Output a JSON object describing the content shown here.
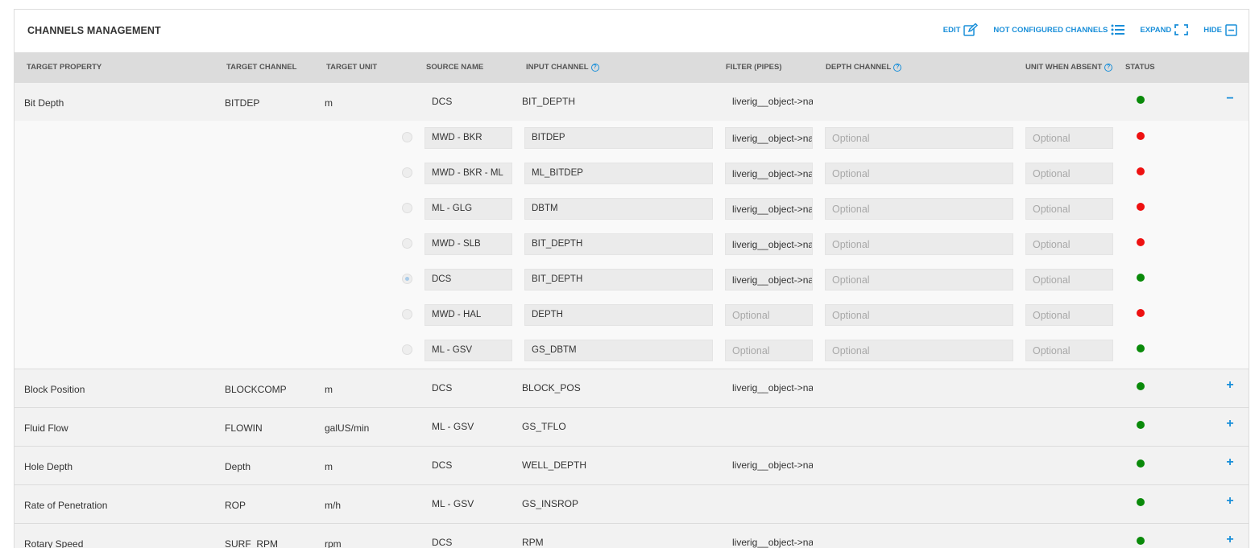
{
  "header": {
    "title": "CHANNELS MANAGEMENT",
    "actions": {
      "edit": "EDIT",
      "not_configured": "NOT CONFIGURED CHANNELS",
      "expand": "EXPAND",
      "hide": "HIDE"
    }
  },
  "columns": {
    "target_property": "TARGET PROPERTY",
    "target_channel": "TARGET CHANNEL",
    "target_unit": "TARGET UNIT",
    "source_name": "SOURCE NAME",
    "input_channel": "INPUT CHANNEL",
    "filter": "FILTER (PIPES)",
    "depth_channel": "DEPTH CHANNEL",
    "unit_when_absent": "UNIT WHEN ABSENT",
    "status": "STATUS"
  },
  "colors": {
    "accent": "#1a8fd9",
    "status_ok": "#0a8a0a",
    "status_error": "#ee1111"
  },
  "placeholder": "Optional",
  "rows": [
    {
      "property": "Bit Depth",
      "channel": "BITDEP",
      "unit": "m",
      "source": "DCS",
      "input": "BIT_DEPTH",
      "filter": "liverig__object->name",
      "status": "ok",
      "toggle": "−"
    },
    {
      "property": "Block Position",
      "channel": "BLOCKCOMP",
      "unit": "m",
      "source": "DCS",
      "input": "BLOCK_POS",
      "filter": "liverig__object->name",
      "status": "ok",
      "toggle": "+"
    },
    {
      "property": "Fluid Flow",
      "channel": "FLOWIN",
      "unit": "galUS/min",
      "source": "ML - GSV",
      "input": "GS_TFLO",
      "filter": "",
      "status": "ok",
      "toggle": "+"
    },
    {
      "property": "Hole Depth",
      "channel": "Depth",
      "unit": "m",
      "source": "DCS",
      "input": "WELL_DEPTH",
      "filter": "liverig__object->name",
      "status": "ok",
      "toggle": "+"
    },
    {
      "property": "Rate of Penetration",
      "channel": "ROP",
      "unit": "m/h",
      "source": "ML - GSV",
      "input": "GS_INSROP",
      "filter": "",
      "status": "ok",
      "toggle": "+"
    },
    {
      "property": "Rotary Speed",
      "channel": "SURF_RPM",
      "unit": "rpm",
      "source": "DCS",
      "input": "RPM",
      "filter": "liverig__object->name",
      "status": "ok",
      "toggle": "+"
    }
  ],
  "sources": [
    {
      "source": "MWD - BKR",
      "input": "BITDEP",
      "filter": "liverig__object->name",
      "selected": false,
      "status": "error"
    },
    {
      "source": "MWD - BKR - ML",
      "input": "ML_BITDEP",
      "filter": "liverig__object->name",
      "selected": false,
      "status": "error"
    },
    {
      "source": "ML - GLG",
      "input": "DBTM",
      "filter": "liverig__object->name",
      "selected": false,
      "status": "error"
    },
    {
      "source": "MWD - SLB",
      "input": "BIT_DEPTH",
      "filter": "liverig__object->name",
      "selected": false,
      "status": "error"
    },
    {
      "source": "DCS",
      "input": "BIT_DEPTH",
      "filter": "liverig__object->name",
      "selected": true,
      "status": "ok"
    },
    {
      "source": "MWD - HAL",
      "input": "DEPTH",
      "filter": "",
      "selected": false,
      "status": "error"
    },
    {
      "source": "ML - GSV",
      "input": "GS_DBTM",
      "filter": "",
      "selected": false,
      "status": "ok"
    }
  ]
}
